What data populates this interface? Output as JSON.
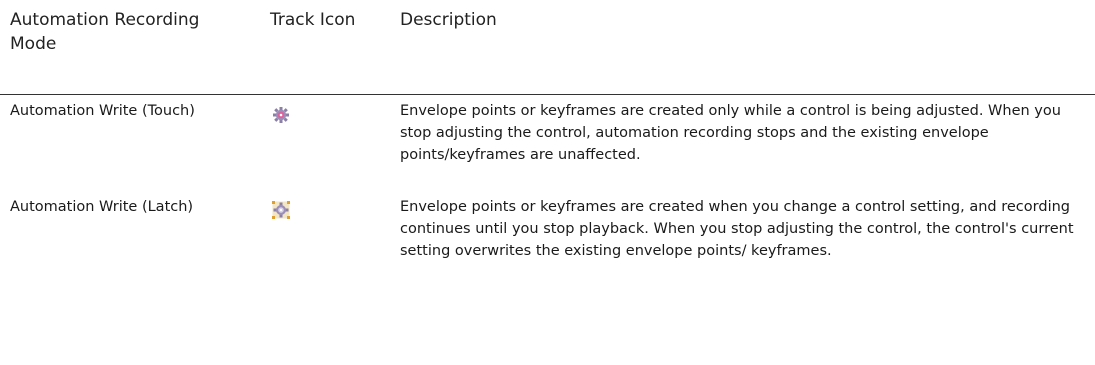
{
  "table": {
    "headers": {
      "mode": "Automation Recording Mode",
      "icon": "Track Icon",
      "description": "Description"
    },
    "rows": [
      {
        "mode": "Automation Write (Touch)",
        "icon": "automation-touch-icon",
        "description": "Envelope points or keyframes are created only while a control is being adjusted. When you stop adjusting the control, automation recording stops and the existing envelope points/keyframes are unaffected."
      },
      {
        "mode": "Automation Write (Latch)",
        "icon": "automation-latch-icon",
        "description": "Envelope points or keyframes are created when you change a control setting, and recording continues until you stop playback. When you stop adjusting the control, the control's current setting overwrites the existing envelope points/ keyframes."
      }
    ]
  }
}
